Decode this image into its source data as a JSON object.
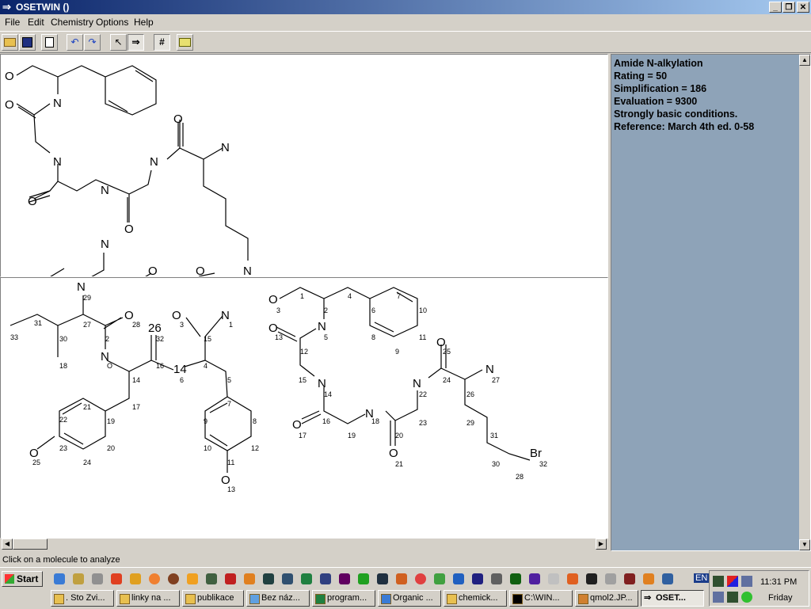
{
  "window": {
    "title": "OSETWIN ()"
  },
  "menu": [
    "File",
    "Edit",
    "Chemistry",
    "Options",
    "Help"
  ],
  "toolbar": {
    "buttons": [
      "open-icon",
      "save-icon",
      "copy-icon",
      "undo-icon",
      "redo-icon",
      "select-arrow-icon",
      "forward-arrow-icon",
      "grid-icon",
      "export-icon"
    ],
    "grid_glyph": "#"
  },
  "info_panel": {
    "lines": [
      "Amide N-alkylation",
      "Rating = 50",
      "Simplification = 186",
      "Evaluation = 9300",
      "Strongly basic conditions.",
      "Reference: March 4th ed. 0-58"
    ]
  },
  "status_text": "Click on a molecule to analyze",
  "taskbar": {
    "start_label": "Start",
    "tasks": [
      ". Sto Zvi...",
      "linky na ...",
      "publikace",
      "Bez náz...",
      "program...",
      "Organic ...",
      "chemick...",
      "C:\\WIN...",
      "qmol2.JP...",
      "OSET..."
    ],
    "active_task": 9,
    "lang": "EN",
    "clock": "11:31 PM",
    "day": "Friday"
  },
  "molecules": {
    "left_labels": [
      "N",
      "29",
      "33",
      "31",
      "27",
      "O",
      "28",
      "O",
      "3",
      "N",
      "1",
      "30",
      "26",
      "2",
      "15",
      "32",
      "N",
      "18",
      "O",
      "16",
      "14",
      "N",
      "6",
      "4",
      "5",
      "17",
      "21",
      "22",
      "19",
      "7",
      "9",
      "8",
      "O",
      "23",
      "25",
      "24",
      "20",
      "10",
      "12",
      "11",
      "O",
      "13"
    ],
    "right_labels": [
      "O",
      "3",
      "1",
      "2",
      "4",
      "6",
      "7",
      "10",
      "N",
      "5",
      "O",
      "13",
      "12",
      "8",
      "9",
      "11",
      "O",
      "25",
      "N",
      "27",
      "24",
      "26",
      "15",
      "N",
      "14",
      "N",
      "22",
      "23",
      "29",
      "O",
      "17",
      "16",
      "N",
      "18",
      "19",
      "20",
      "O",
      "21",
      "31",
      "30",
      "Br",
      "32",
      "28"
    ],
    "top_labels": [
      "O",
      "O",
      "N",
      "O",
      "N",
      "N",
      "N",
      "O",
      "O",
      "N",
      "N",
      "O",
      "O",
      "N"
    ]
  }
}
